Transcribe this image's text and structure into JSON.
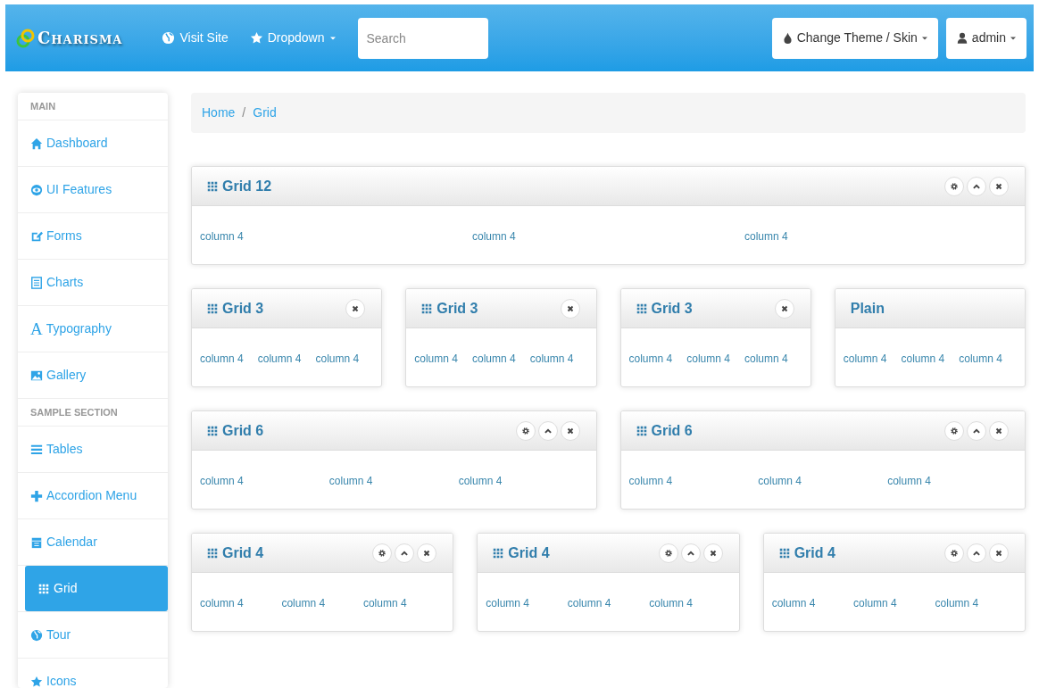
{
  "navbar": {
    "brand": "Charisma",
    "links": [
      {
        "kind": "globe",
        "label": "Visit Site",
        "caret": false
      },
      {
        "kind": "star",
        "label": "Dropdown",
        "caret": true
      }
    ],
    "search": {
      "placeholder": "Search"
    },
    "buttons": [
      {
        "kind": "drop",
        "label": "Change Theme / Skin"
      },
      {
        "kind": "user",
        "label": "admin"
      }
    ]
  },
  "sidebar": {
    "sections": [
      {
        "heading": "MAIN",
        "items": [
          {
            "label": "Dashboard",
            "selected": false
          },
          {
            "label": "UI Features",
            "selected": false
          },
          {
            "label": "Forms",
            "selected": false
          },
          {
            "label": "Charts",
            "selected": false
          },
          {
            "label": "Typography",
            "selected": false,
            "glyph": "A"
          },
          {
            "label": "Gallery",
            "selected": false
          }
        ]
      },
      {
        "heading": "SAMPLE SECTION",
        "items": [
          {
            "label": "Tables",
            "selected": false
          },
          {
            "label": "Accordion Menu",
            "selected": false
          },
          {
            "label": "Calendar",
            "selected": false
          },
          {
            "label": "Grid",
            "selected": true
          },
          {
            "label": "Tour",
            "selected": false
          },
          {
            "label": "Icons",
            "selected": false
          }
        ]
      }
    ]
  },
  "breadcrumb": {
    "items": [
      "Home",
      "Grid"
    ],
    "separator": "/"
  },
  "rows": [
    [
      {
        "title": "Grid 12",
        "icon": true,
        "controls": [
          {
            "kind": "settings"
          },
          {
            "kind": "collapse"
          },
          {
            "kind": "close"
          }
        ],
        "columns": [
          "column 4",
          "column 4",
          "column 4"
        ]
      }
    ],
    [
      {
        "title": "Grid 3",
        "icon": true,
        "controls": [
          {
            "kind": "close"
          }
        ],
        "columns": [
          "column 4",
          "column 4",
          "column 4"
        ]
      },
      {
        "title": "Grid 3",
        "icon": true,
        "controls": [
          {
            "kind": "close"
          }
        ],
        "columns": [
          "column 4",
          "column 4",
          "column 4"
        ]
      },
      {
        "title": "Grid 3",
        "icon": true,
        "controls": [
          {
            "kind": "close"
          }
        ],
        "columns": [
          "column 4",
          "column 4",
          "column 4"
        ]
      },
      {
        "title": "Plain",
        "icon": false,
        "columns": [
          "column 4",
          "column 4",
          "column 4"
        ]
      }
    ],
    [
      {
        "title": "Grid 6",
        "icon": true,
        "controls": [
          {
            "kind": "settings"
          },
          {
            "kind": "collapse"
          },
          {
            "kind": "close"
          }
        ],
        "columns": [
          "column 4",
          "column 4",
          "column 4"
        ]
      },
      {
        "title": "Grid 6",
        "icon": true,
        "controls": [
          {
            "kind": "settings"
          },
          {
            "kind": "collapse"
          },
          {
            "kind": "close"
          }
        ],
        "columns": [
          "column 4",
          "column 4",
          "column 4"
        ]
      }
    ],
    [
      {
        "title": "Grid 4",
        "icon": true,
        "controls": [
          {
            "kind": "settings"
          },
          {
            "kind": "collapse"
          },
          {
            "kind": "close"
          }
        ],
        "columns": [
          "column 4",
          "column 4",
          "column 4"
        ]
      },
      {
        "title": "Grid 4",
        "icon": true,
        "controls": [
          {
            "kind": "settings"
          },
          {
            "kind": "collapse"
          },
          {
            "kind": "close"
          }
        ],
        "columns": [
          "column 4",
          "column 4",
          "column 4"
        ]
      },
      {
        "title": "Grid 4",
        "icon": true,
        "controls": [
          {
            "kind": "settings"
          },
          {
            "kind": "collapse"
          },
          {
            "kind": "close"
          }
        ],
        "columns": [
          "column 4",
          "column 4",
          "column 4"
        ]
      }
    ]
  ]
}
